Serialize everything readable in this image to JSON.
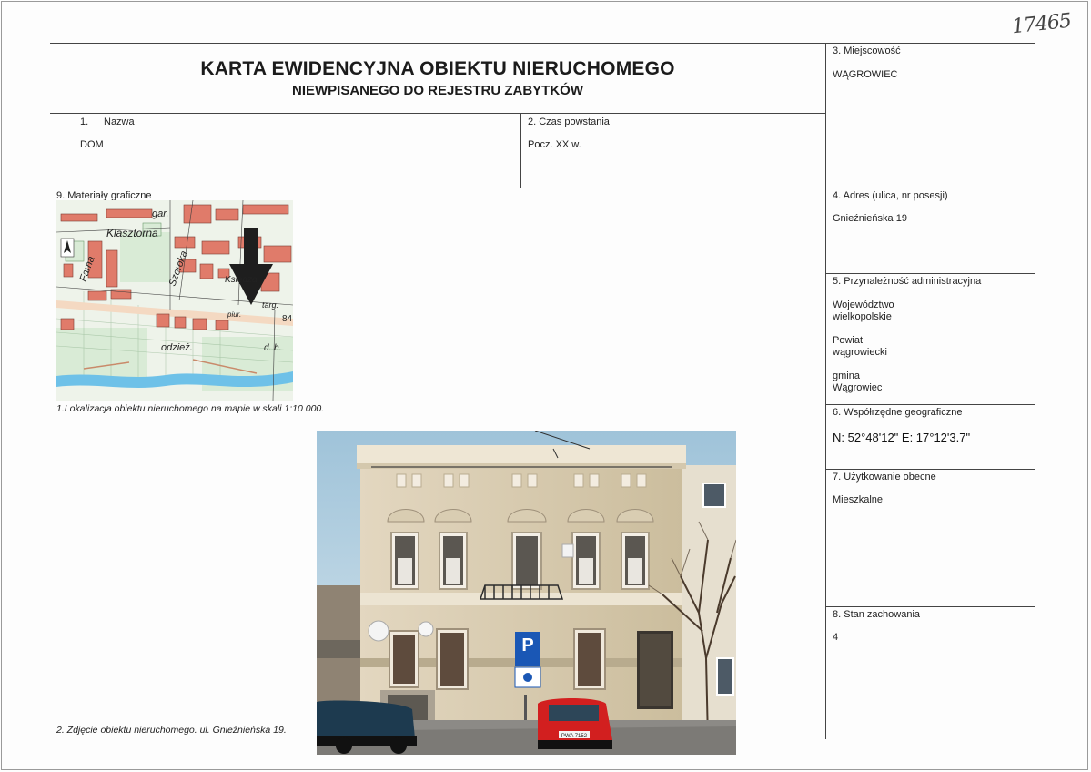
{
  "annotation": "17465",
  "title": {
    "line1": "KARTA EWIDENCYJNA OBIEKTU NIERUCHOMEGO",
    "line2": "NIEWPISANEGO DO REJESTRU ZABYTKÓW"
  },
  "fields": {
    "name": {
      "label_num": "1.",
      "label": "Nazwa",
      "value": "DOM"
    },
    "time": {
      "label": "2. Czas powstania",
      "value": "Pocz. XX w."
    },
    "locality": {
      "label": "3. Miejscowość",
      "value": "WĄGROWIEC"
    },
    "address": {
      "label": "4. Adres (ulica, nr posesji)",
      "value": "Gnieźnieńska 19"
    },
    "admin": {
      "label": "5. Przynależność administracyjna",
      "voivodeship_1": "Województwo",
      "voivodeship_2": "wielkopolskie",
      "county_1": "Powiat",
      "county_2": "wągrowiecki",
      "gmina_1": "gmina",
      "gmina_2": "Wągrowiec"
    },
    "coords": {
      "label": "6. Współrzędne geograficzne",
      "value": "N: 52°48'12\"  E: 17°12'3.7\""
    },
    "usage": {
      "label": "7. Użytkowanie obecne",
      "value": "Mieszkalne"
    },
    "condition": {
      "label": "8. Stan zachowania",
      "value": "4"
    },
    "graphics": {
      "label": "9. Materiały graficzne"
    }
  },
  "map": {
    "labels": {
      "gar": "gar.",
      "klasztorna": "Klasztorna",
      "farna": "Farna",
      "szeroka": "Szeroka",
      "ksiedza": "Księdza",
      "targ": "targ.",
      "piur": "piur.",
      "num": "84",
      "odziez": "odzież.",
      "dh": "d. h."
    }
  },
  "photo": {
    "sign_letter": "P",
    "plate": "PWA 7152"
  },
  "captions": {
    "map": "1.Lokalizacja obiektu nieruchomego na mapie w skali 1:10 000.",
    "photo": "2. Zdjęcie obiektu nieruchomego. ul. Gnieźnieńska 19."
  }
}
